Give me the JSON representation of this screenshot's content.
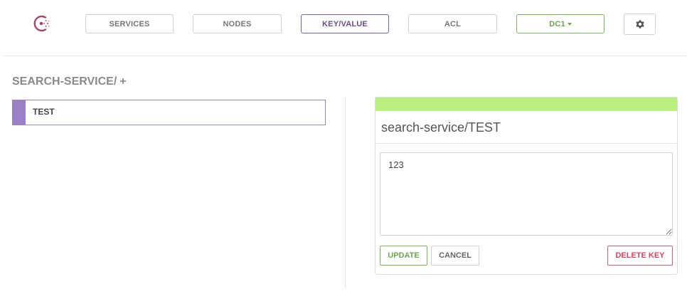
{
  "nav": {
    "services": "SERVICES",
    "nodes": "NODES",
    "keyvalue": "KEY/VALUE",
    "acl": "ACL",
    "datacenter": "DC1"
  },
  "icons": {
    "logo": "consul-logo-icon",
    "settings": "gear-icon",
    "dropdown": "caret-down-icon"
  },
  "breadcrumb": {
    "path": "SEARCH-SERVICE/",
    "add": "+"
  },
  "keys": [
    {
      "label": "TEST"
    }
  ],
  "editor": {
    "title": "search-service/TEST",
    "value": "123",
    "update": "UPDATE",
    "cancel": "CANCEL",
    "delete": "DELETE KEY"
  },
  "colors": {
    "accent_purple": "#7d5ea3",
    "accent_green": "#6aa84f",
    "panel_header": "#b8ef7e",
    "danger": "#d9435a"
  }
}
